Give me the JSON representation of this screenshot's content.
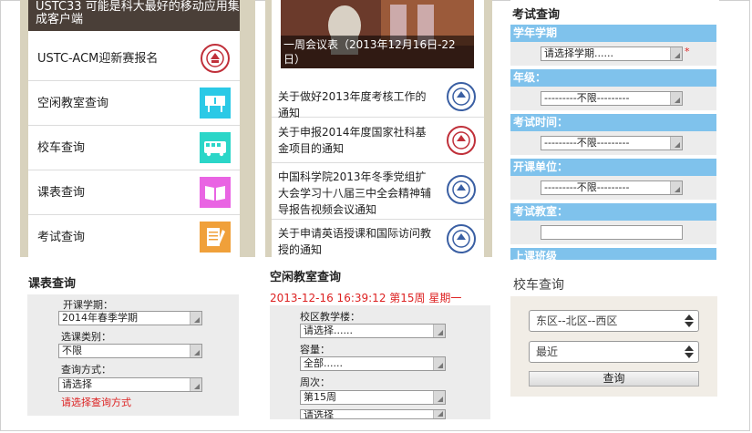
{
  "panel_menu": {
    "banner_text": "USTC33 可能是科大最好的移动应用集成客户端",
    "items": [
      {
        "label": "USTC-ACM迎新赛报名",
        "icon": "ustc-seal-icon"
      },
      {
        "label": "空闲教室查询",
        "icon": "classroom-icon"
      },
      {
        "label": "校车查询",
        "icon": "bus-icon"
      },
      {
        "label": "课表查询",
        "icon": "book-icon"
      },
      {
        "label": "考试查询",
        "icon": "exam-icon"
      }
    ]
  },
  "panel_news": {
    "photo_caption": "一周会议表（2013年12月16日-22日）",
    "items": [
      {
        "label": "关于做好2013年度考核工作的通知"
      },
      {
        "label": "关于申报2014年度国家社科基金项目的通知"
      },
      {
        "label": "中国科学院2013年冬季党组扩大会学习十八届三中全会精神辅导报告视频会议通知"
      },
      {
        "label": "关于申请英语授课和国际访问教授的通知"
      }
    ]
  },
  "panel_exam": {
    "title": "考试查询",
    "fields": [
      {
        "label": "学年学期",
        "value": "请选择学期......",
        "required": "*"
      },
      {
        "label": "年级：",
        "value": "---------不限---------"
      },
      {
        "label": "考试时间：",
        "value": "---------不限---------"
      },
      {
        "label": "开课单位：",
        "value": "---------不限---------"
      },
      {
        "label": "考试教室：",
        "value": ""
      },
      {
        "label": "上课班级",
        "value": ""
      }
    ]
  },
  "panel_schedule": {
    "title": "课表查询",
    "fields": [
      {
        "label": "开课学期：",
        "value": "2014年春季学期"
      },
      {
        "label": "选课类别：",
        "value": "不限"
      },
      {
        "label": "查询方式：",
        "value": "请选择"
      }
    ],
    "error": "请选择查询方式"
  },
  "panel_classroom": {
    "title": "空闲教室查询",
    "datetime": "2013-12-16 16:39:12 第15周 星期一",
    "fields": [
      {
        "label": "校区教学楼：",
        "value": "请选择......"
      },
      {
        "label": "容量：",
        "value": "全部......"
      },
      {
        "label": "周次：",
        "value": "第15周"
      },
      {
        "label": "",
        "value": "请选择"
      }
    ]
  },
  "panel_bus": {
    "title": "校车查询",
    "route": "东区--北区--西区",
    "time": "最近",
    "button": "查询"
  },
  "colors": {
    "accent_blue": "#7fc2ec",
    "error_red": "#dd2222",
    "frame_bg": "#d8d2bd"
  }
}
